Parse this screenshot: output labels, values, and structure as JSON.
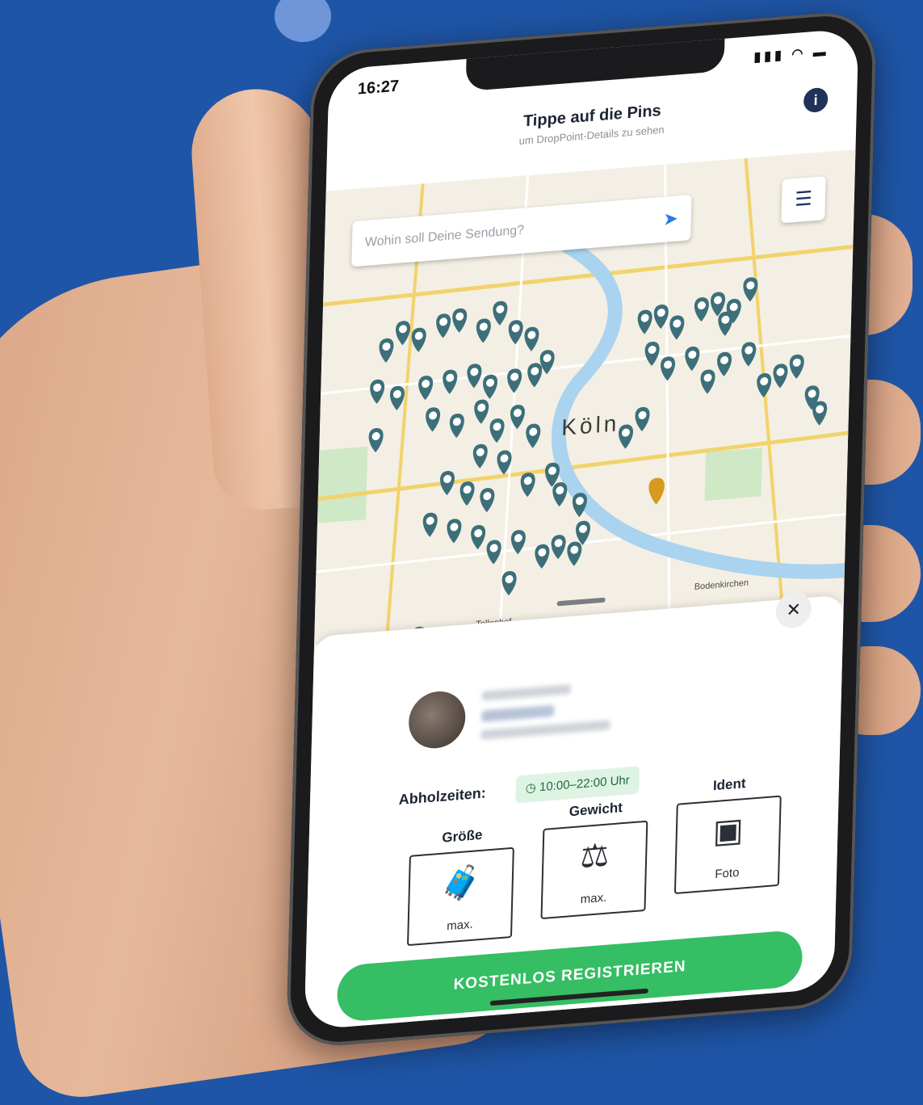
{
  "status": {
    "time": "16:27",
    "icons": "▮▮▮ ◠ ▬"
  },
  "header": {
    "title": "Tippe auf die Pins",
    "subtitle": "um DropPoint-Details zu sehen",
    "info_label": "i"
  },
  "map": {
    "search_placeholder": "Wohin soll Deine Sendung?",
    "city_label": "Köln",
    "labels": [
      "Bodenkirchen",
      "Tollenhof"
    ]
  },
  "sheet": {
    "pickup_label": "Abholzeiten:",
    "hours": "10:00–22:00 Uhr",
    "specs": [
      {
        "label": "Größe",
        "icon": "suitcase-icon",
        "value": "max."
      },
      {
        "label": "Gewicht",
        "icon": "weight-icon",
        "value": "max."
      },
      {
        "label": "Ident",
        "icon": "id-photo-icon",
        "value": "Foto"
      }
    ],
    "cta": "KOSTENLOS REGISTRIEREN"
  },
  "colors": {
    "background": "#1f55a6",
    "pin": "#3d6f7a",
    "pin_highlight": "#d69a1e",
    "cta": "#35be63",
    "hours_bg": "#dff3e4"
  }
}
